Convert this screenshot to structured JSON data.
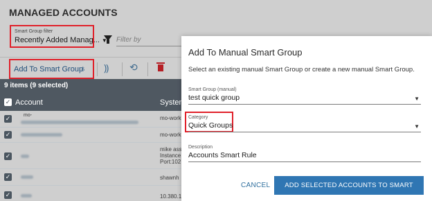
{
  "page": {
    "title": "MANAGED ACCOUNTS"
  },
  "filter": {
    "label": "Smart Group filter",
    "value": "Recently Added Manag...",
    "caret": "▼",
    "filter_placeholder": "Filter by"
  },
  "toolbar": {
    "add_label": "Add To Smart Group",
    "add_icon": "♁",
    "icon2": "⸩",
    "icon3": "⟲"
  },
  "table": {
    "selection_text": "9 items (9 selected)",
    "columns": [
      "Account",
      "System"
    ],
    "check": "✓",
    "rows": [
      {
        "account_visible": "mo-",
        "system": "mo-work"
      },
      {
        "account_visible": "",
        "system": "mo-work"
      },
      {
        "account_visible": "",
        "system": "mike ass\nInstance\nPort:102"
      },
      {
        "account_visible": "",
        "system": "shawnh"
      },
      {
        "account_visible": "",
        "system": "10.380.1"
      }
    ]
  },
  "dialog": {
    "title": "Add To Manual Smart Group",
    "description": "Select an existing manual Smart Group or create a new manual Smart Group.",
    "smart_group_label": "Smart Group (manual)",
    "smart_group_value": "test quick group",
    "category_label": "Category",
    "category_value": "Quick Groups",
    "description_label": "Description",
    "description_value": "Accounts Smart Rule",
    "caret": "▼",
    "cancel_label": "CANCEL",
    "submit_label": "ADD SELECTED ACCOUNTS TO SMART GROUP"
  },
  "colors": {
    "highlight": "#e0202a",
    "primary_button": "#2f76b3",
    "table_header": "#4f5861"
  }
}
